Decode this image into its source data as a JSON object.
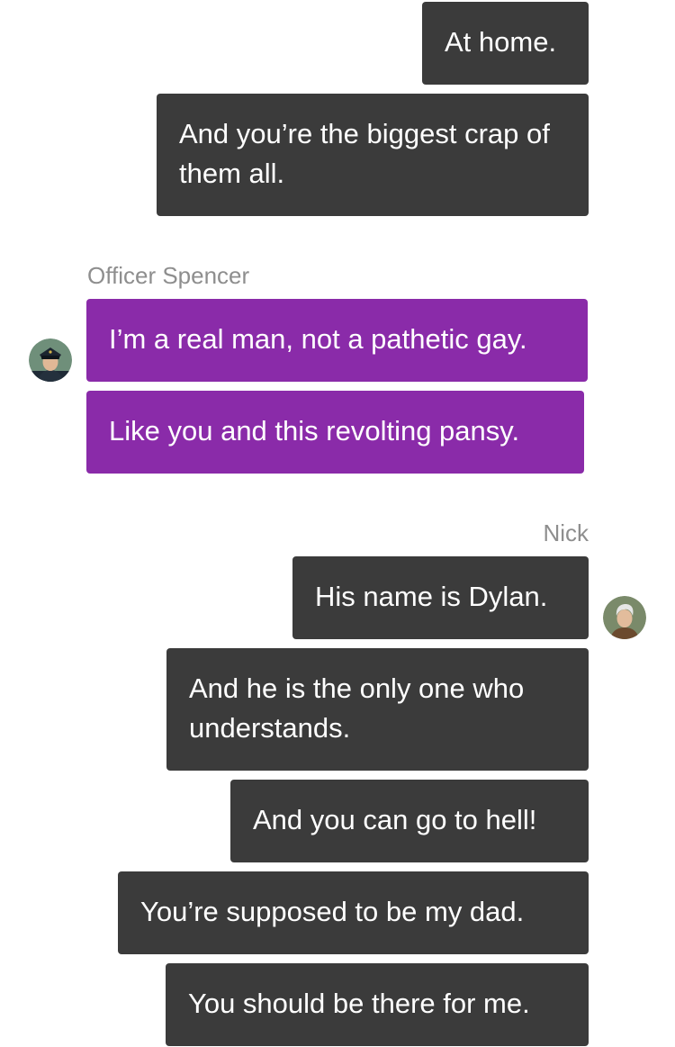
{
  "messages": {
    "m1": "At home.",
    "m2": "And you’re the biggest crap of them all.",
    "m3": "I’m a real man, not a pathetic gay.",
    "m4": "Like you and this revolting pansy.",
    "m5": "His name is Dylan.",
    "m6": "And he is the only one who understands.",
    "m7": "And you can go to hell!",
    "m8": "You’re supposed to be my dad.",
    "m9": "You should be there for me."
  },
  "senders": {
    "officer": "Officer Spencer",
    "nick": "Nick"
  },
  "avatars": {
    "officer": "police-officer-avatar-icon",
    "nick": "gray-haired-man-avatar-icon"
  },
  "colors": {
    "outgoing_bubble": "#3b3b3b",
    "incoming_bubble": "#8a2ba9",
    "sender_label": "#8e8e8e",
    "background": "#ffffff"
  }
}
